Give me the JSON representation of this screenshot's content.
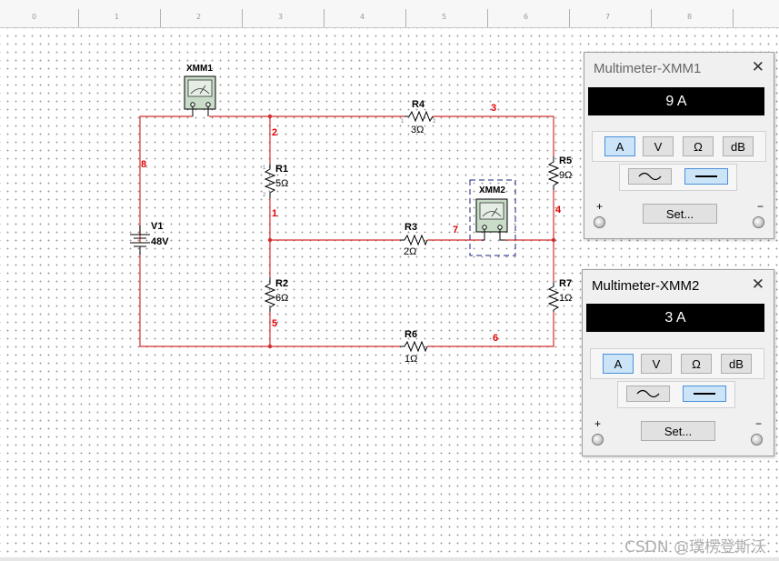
{
  "ruler": {
    "ticks": [
      "0",
      "1",
      "2",
      "3",
      "4",
      "5",
      "6",
      "7",
      "8"
    ]
  },
  "circuit": {
    "components": {
      "V1": {
        "name": "V1",
        "value": "48V"
      },
      "R1": {
        "name": "R1",
        "value": "5Ω"
      },
      "R2": {
        "name": "R2",
        "value": "6Ω"
      },
      "R3": {
        "name": "R3",
        "value": "2Ω"
      },
      "R4": {
        "name": "R4",
        "value": "3Ω"
      },
      "R5": {
        "name": "R5",
        "value": "9Ω"
      },
      "R6": {
        "name": "R6",
        "value": "1Ω"
      },
      "R7": {
        "name": "R7",
        "value": "1Ω"
      },
      "XMM1": {
        "name": "XMM1"
      },
      "XMM2": {
        "name": "XMM2"
      }
    },
    "nodes": {
      "n1": "1",
      "n2": "2",
      "n3": "3",
      "n4": "4",
      "n5": "5",
      "n6": "6",
      "n7": "7",
      "n8": "8"
    },
    "pins": {
      "p1": "1",
      "p2": "2"
    }
  },
  "mm1": {
    "title": "Multimeter-XMM1",
    "close": "✕",
    "reading": "9 A",
    "modes": {
      "amp": "A",
      "volt": "V",
      "ohm": "Ω",
      "db": "dB"
    },
    "active_mode": "A",
    "plus": "+",
    "minus": "−",
    "set_label": "Set..."
  },
  "mm2": {
    "title": "Multimeter-XMM2",
    "close": "✕",
    "reading": "3 A",
    "modes": {
      "amp": "A",
      "volt": "V",
      "ohm": "Ω",
      "db": "dB"
    },
    "active_mode": "A",
    "plus": "+",
    "minus": "−",
    "set_label": "Set..."
  },
  "watermark": "CSDN @璞楞登斯沃",
  "colors": {
    "wire": "#d32f2f",
    "node_label": "#e00000",
    "active_button": "#cce4f7",
    "meter_body": "#c8dcc8"
  }
}
